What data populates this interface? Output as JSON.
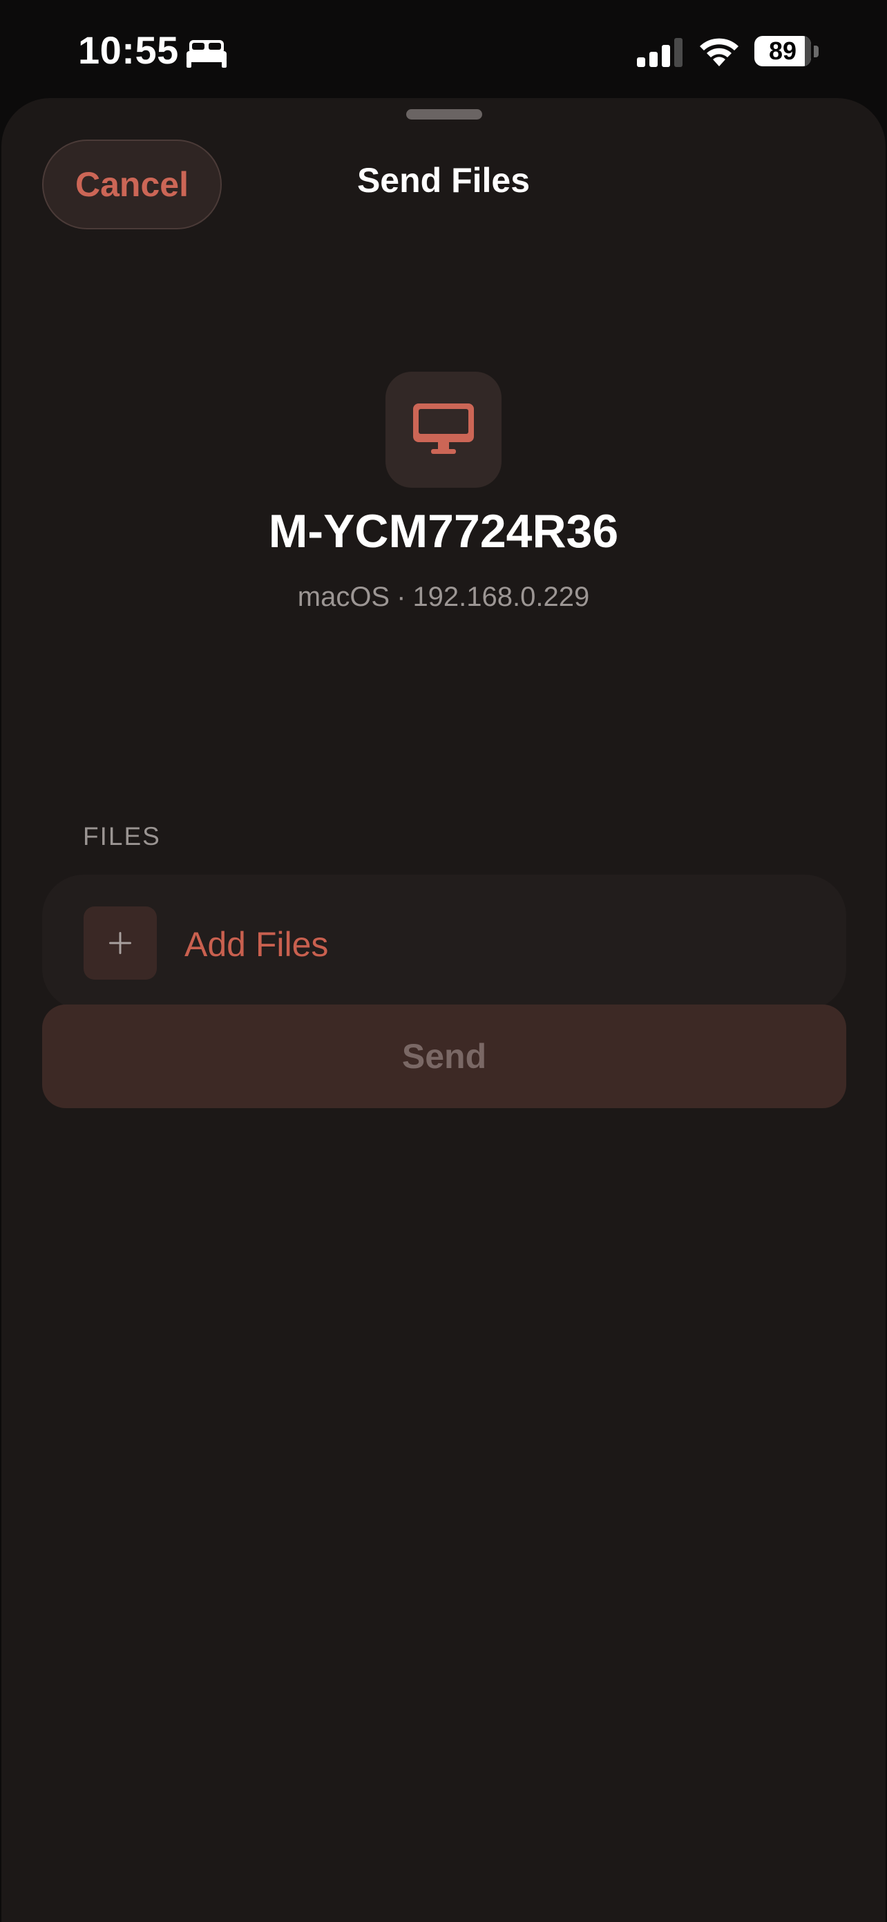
{
  "status_bar": {
    "time": "10:55",
    "focus_mode_icon": "bed-icon",
    "battery_level": 89,
    "battery_label": "89"
  },
  "sheet": {
    "title": "Send Files",
    "cancel_label": "Cancel"
  },
  "device": {
    "icon": "desktop-computer-icon",
    "name": "M-YCM7724R36",
    "os": "macOS",
    "separator": "·",
    "ip": "192.168.0.229"
  },
  "files_section": {
    "header": "FILES",
    "add_label": "Add Files",
    "add_icon": "plus-icon"
  },
  "send_label": "Send",
  "colors": {
    "accent": "#cc6656",
    "background": "#1c1817",
    "send_disabled": "#3d2925"
  }
}
